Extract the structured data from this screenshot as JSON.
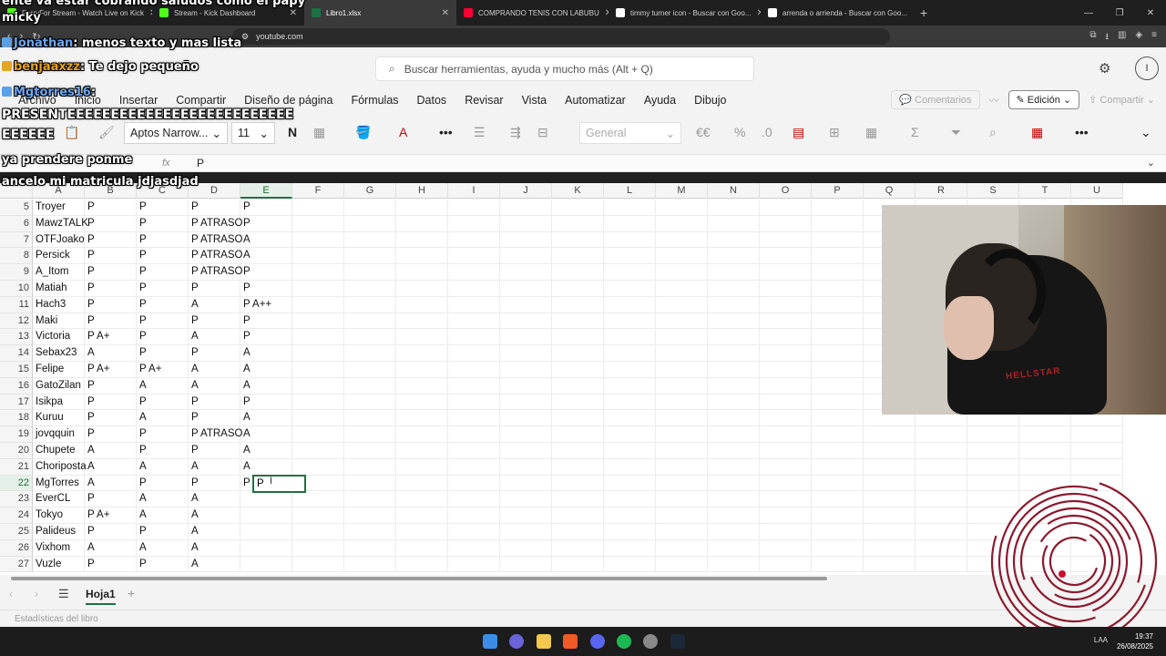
{
  "browser": {
    "tabs": [
      {
        "label": "PerryFor Stream - Watch Live on Kick",
        "color": "#53fc18",
        "active": false
      },
      {
        "label": "Stream - Kick Dashboard",
        "color": "#53fc18",
        "active": false
      },
      {
        "label": "Libro1.xlsx",
        "color": "#1e7145",
        "active": true
      },
      {
        "label": "COMPRANDO TENIS CON LABUBU",
        "color": "#ff0033",
        "active": false
      },
      {
        "label": "timmy turner icon - Buscar con Goo...",
        "color": "#ffffff",
        "active": false
      },
      {
        "label": "arrenda o arrienda - Buscar con Goo...",
        "color": "#ffffff",
        "active": false
      }
    ],
    "url": "youtube.com"
  },
  "excel": {
    "search_placeholder": "Buscar herramientas, ayuda y mucho más (Alt + Q)",
    "avatar_initial": "I",
    "menu": [
      "Archivo",
      "Inicio",
      "Insertar",
      "Compartir",
      "Diseño de página",
      "Fórmulas",
      "Datos",
      "Revisar",
      "Vista",
      "Automatizar",
      "Ayuda",
      "Dibujo"
    ],
    "comments_label": "Comentarios",
    "edit_mode_label": "Edición",
    "share_label": "Compartir",
    "font_name": "Aptos Narrow...",
    "font_size": "11",
    "bold_label": "N",
    "number_format": "General",
    "formula_fx": "fx",
    "formula_value": "P",
    "columns": [
      "A",
      "B",
      "C",
      "D",
      "E",
      "F",
      "G",
      "H",
      "I",
      "J",
      "K",
      "L",
      "M",
      "N",
      "O",
      "P",
      "Q",
      "R",
      "S",
      "T",
      "U"
    ],
    "selected_column": "E",
    "selected_row": "22",
    "rows": [
      {
        "num": "5",
        "cells": [
          "Troyer",
          "P",
          "P",
          "P",
          "P"
        ]
      },
      {
        "num": "6",
        "cells": [
          "MawzTALK",
          "P",
          "P",
          "P ATRASO",
          "P"
        ]
      },
      {
        "num": "7",
        "cells": [
          "OTFJoako",
          "P",
          "P",
          "P ATRASO",
          "A"
        ]
      },
      {
        "num": "8",
        "cells": [
          "Persick",
          "P",
          "P",
          "P ATRASO",
          "A"
        ]
      },
      {
        "num": "9",
        "cells": [
          "A_Itom",
          "P",
          "P",
          "P ATRASO",
          "P"
        ]
      },
      {
        "num": "10",
        "cells": [
          "Matiah",
          "P",
          "P",
          "P",
          "P"
        ]
      },
      {
        "num": "11",
        "cells": [
          "Hach3",
          "P",
          "P",
          "A",
          "P A++"
        ]
      },
      {
        "num": "12",
        "cells": [
          "Maki",
          "P",
          "P",
          "P",
          "P"
        ]
      },
      {
        "num": "13",
        "cells": [
          "Victoria",
          "P A+",
          "P",
          "A",
          "P"
        ]
      },
      {
        "num": "14",
        "cells": [
          "Sebax23",
          "A",
          "P",
          "P",
          "A"
        ]
      },
      {
        "num": "15",
        "cells": [
          "Felipe",
          "P A+",
          "P A+",
          "A",
          "A"
        ]
      },
      {
        "num": "16",
        "cells": [
          "GatoZilan",
          "P",
          "A",
          "A",
          "A"
        ]
      },
      {
        "num": "17",
        "cells": [
          "Isikpa",
          "P",
          "P",
          "P",
          "P"
        ]
      },
      {
        "num": "18",
        "cells": [
          "Kuruu",
          "P",
          "A",
          "P",
          "A"
        ]
      },
      {
        "num": "19",
        "cells": [
          "jovqquin",
          "P",
          "P",
          "P ATRASO",
          "A"
        ]
      },
      {
        "num": "20",
        "cells": [
          "Chupete",
          "A",
          "P",
          "P",
          "A"
        ]
      },
      {
        "num": "21",
        "cells": [
          "Choriposta",
          "A",
          "A",
          "A",
          "A"
        ]
      },
      {
        "num": "22",
        "cells": [
          "MgTorres",
          "A",
          "P",
          "P",
          "P"
        ]
      },
      {
        "num": "23",
        "cells": [
          "EverCL",
          "P",
          "A",
          "A",
          ""
        ]
      },
      {
        "num": "24",
        "cells": [
          "Tokyo",
          "P A+",
          "A",
          "A",
          ""
        ]
      },
      {
        "num": "25",
        "cells": [
          "Palideus",
          "P",
          "P",
          "A",
          ""
        ]
      },
      {
        "num": "26",
        "cells": [
          "Vixhom",
          "A",
          "A",
          "A",
          ""
        ]
      },
      {
        "num": "27",
        "cells": [
          "Vuzle",
          "P",
          "P",
          "A",
          ""
        ]
      }
    ],
    "sheet_tab": "Hoja1",
    "status": "Estadísticas del libro"
  },
  "chat": [
    {
      "user": "",
      "text": "ente va estar cobrando saludos como el papy"
    },
    {
      "user": "",
      "text": "micky"
    },
    {
      "user": "Jonathan",
      "text": ": menos texto y mas lista"
    },
    {
      "user": "benjaaxzz",
      "text": ": Te dejo pequeño"
    },
    {
      "user": "Mgtorres16",
      "text": ":"
    },
    {
      "user": "",
      "text": "PRESENTEEEEEEEEEEEEEEEEEEEEEEEEEE"
    },
    {
      "user": "",
      "text": "EEEEEE"
    },
    {
      "user": "",
      "text": "ya prendere ponme"
    },
    {
      "user": "",
      "text": "ancelo mi matricula jdjasdjad"
    }
  ],
  "taskbar": {
    "clock_time": "19:37",
    "clock_date": "26/08/2025",
    "lang": "LAA"
  },
  "webcam": {
    "shirt_text": "HELLSTAR"
  }
}
